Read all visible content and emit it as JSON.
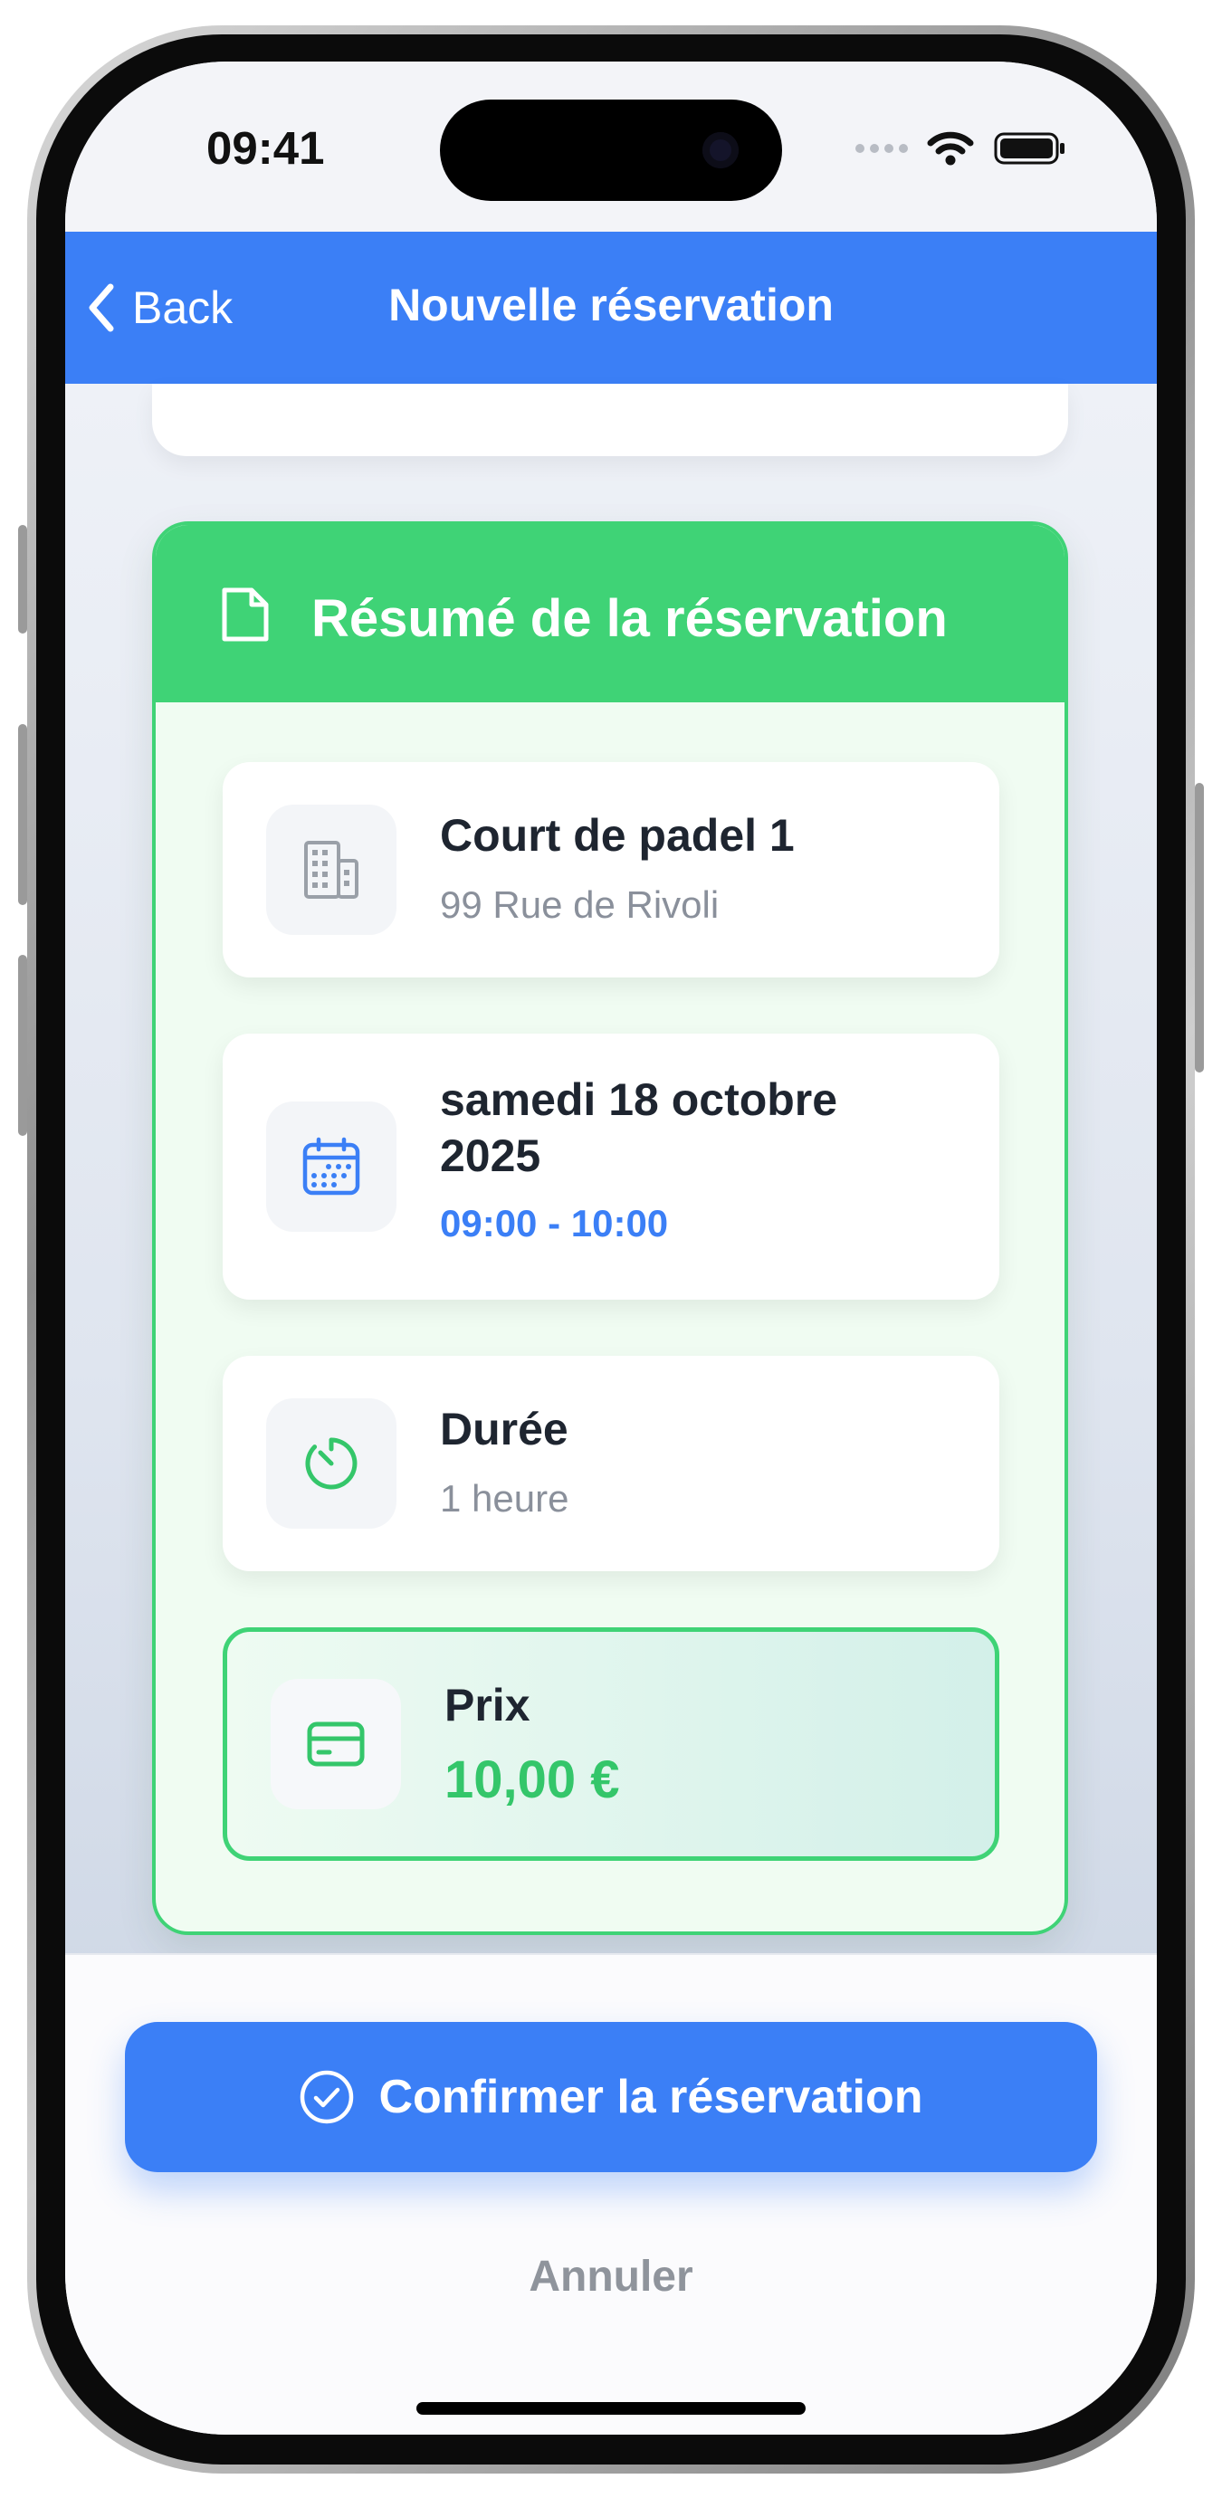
{
  "status_bar": {
    "time": "09:41"
  },
  "nav": {
    "back_label": "Back",
    "title": "Nouvelle réservation"
  },
  "summary": {
    "title": "Résumé de la réservation",
    "court": {
      "name": "Court de padel 1",
      "address": "99 Rue de Rivoli",
      "icon": "building-icon"
    },
    "date": {
      "line1": "samedi 18 octobre",
      "line2": "2025",
      "time": "09:00 - 10:00",
      "icon": "calendar-icon"
    },
    "duration": {
      "label": "Durée",
      "value": "1 heure",
      "icon": "timer-icon"
    },
    "price": {
      "label": "Prix",
      "value": "10,00 €",
      "icon": "credit-card-icon"
    }
  },
  "actions": {
    "confirm_label": "Confirmer la réservation",
    "cancel_label": "Annuler"
  },
  "colors": {
    "primary": "#3b7ff6",
    "success": "#3fd376",
    "muted": "#8f949c"
  }
}
